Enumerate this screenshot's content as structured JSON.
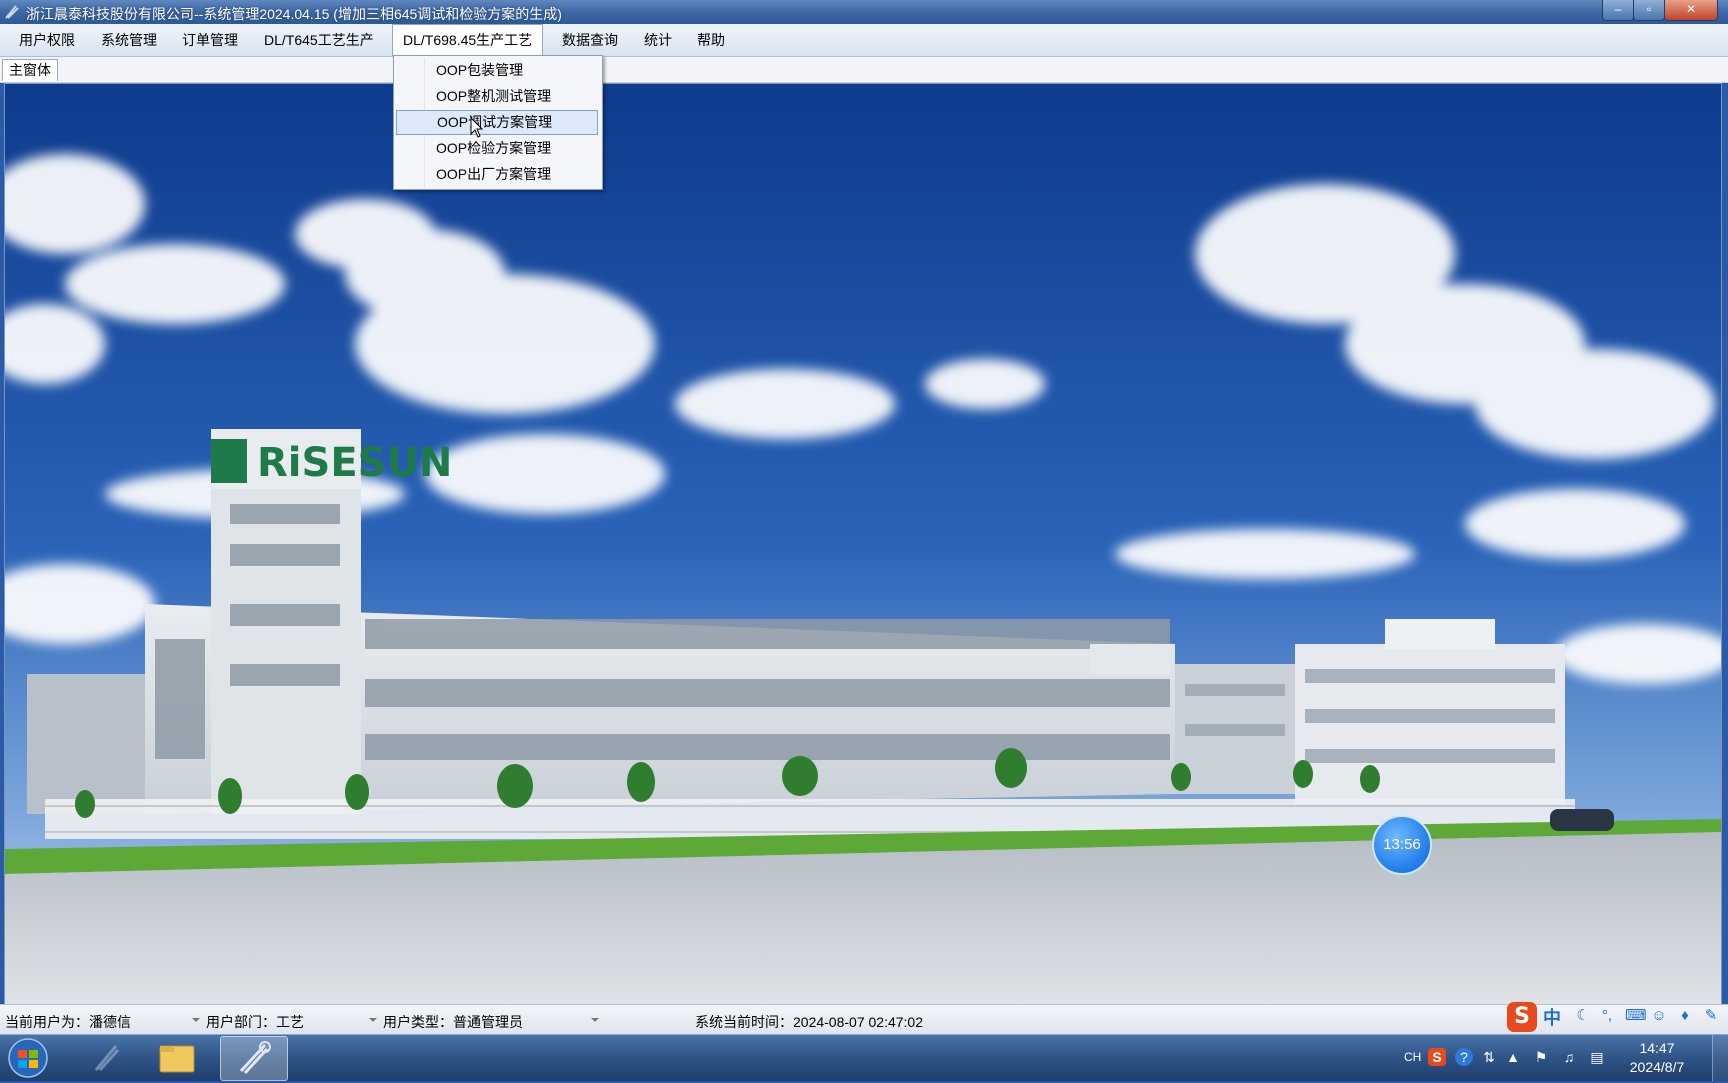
{
  "window": {
    "title": "浙江晨泰科技股份有限公司--系统管理2024.04.15 (增加三相645调试和检验方案的生成)",
    "minimize_label": "–",
    "maximize_label": "▫",
    "close_label": "✕"
  },
  "menubar": {
    "items": [
      "用户权限",
      "系统管理",
      "订单管理",
      "DL/T645工艺生产",
      "DL/T698.45生产工艺",
      "数据查询",
      "统计",
      "帮助"
    ],
    "active_index": 4
  },
  "tabs": {
    "main": "主窗体"
  },
  "dropdown": {
    "items": [
      "OOP包装管理",
      "OOP整机测试管理",
      "OOP调试方案管理",
      "OOP检验方案管理",
      "OOP出厂方案管理"
    ],
    "hover_index": 2
  },
  "scene": {
    "building_sign": "RiSESUN"
  },
  "timer_bubble": "13:56",
  "statusbar": {
    "user_label": "当前用户为：",
    "user_value": "潘德信",
    "dept_label": "用户部门：",
    "dept_value": "工艺",
    "type_label": "用户类型：",
    "type_value": "普通管理员",
    "time_label": "系统当前时间：",
    "time_value": "2024-08-07 02:47:02"
  },
  "ime": {
    "logo": "S",
    "mode": "中"
  },
  "taskbar": {
    "language": "CH",
    "time": "14:47",
    "date": "2024/8/7"
  },
  "colors": {
    "titlebar": "#3f6aa8",
    "menubar": "#dde7f3",
    "sky": "#1e4f9e",
    "taskbar": "#2e5487",
    "ime_logo": "#e8491d"
  }
}
